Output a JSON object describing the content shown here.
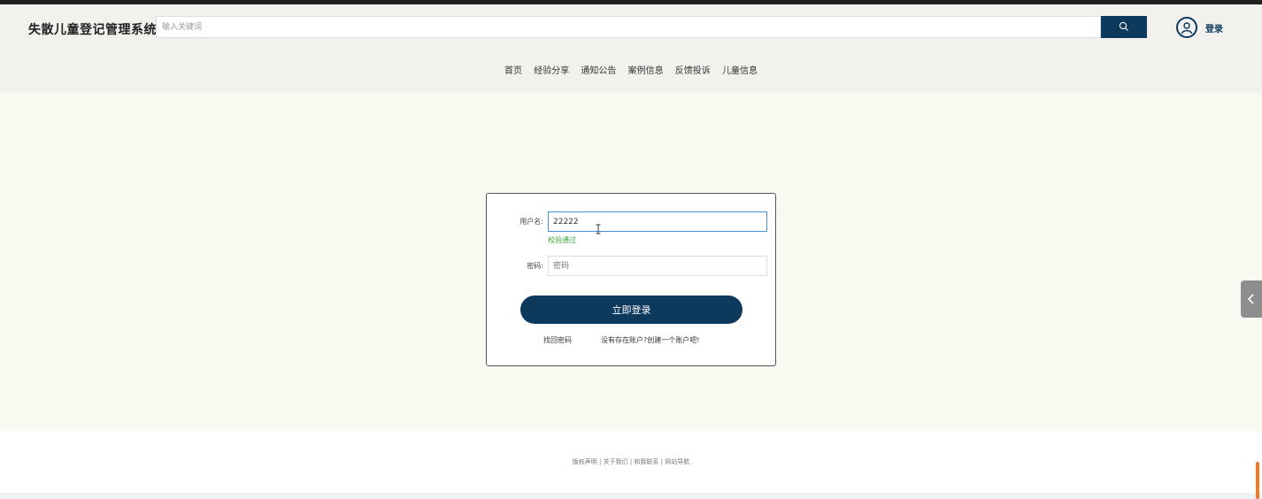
{
  "header": {
    "site_title": "失散儿童登记管理系统",
    "search_placeholder": "输入关键词",
    "login_label": "登录"
  },
  "nav": {
    "items": [
      "首页",
      "经验分享",
      "通知公告",
      "案例信息",
      "反馈投诉",
      "儿童信息"
    ]
  },
  "login_form": {
    "username_label": "用户名:",
    "username_value": "22222",
    "username_valid_msg": "校验通过",
    "password_label": "密码:",
    "password_placeholder": "密码",
    "submit_label": "立即登录",
    "forgot_password": "找回密码",
    "register_link": "没有存在账户?创建一个账户吧!"
  },
  "footer": {
    "links": "版权声明 | 关于我们 | 和我联系 | 网站导航"
  },
  "colors": {
    "primary": "#0d3a5c",
    "valid": "#3aa33a",
    "header_bg": "#f3f1ed",
    "page_bg": "#f9f9f2"
  },
  "icons": {
    "search": "search-icon",
    "user": "user-avatar-icon",
    "side_tab": "chevron-left-icon"
  }
}
